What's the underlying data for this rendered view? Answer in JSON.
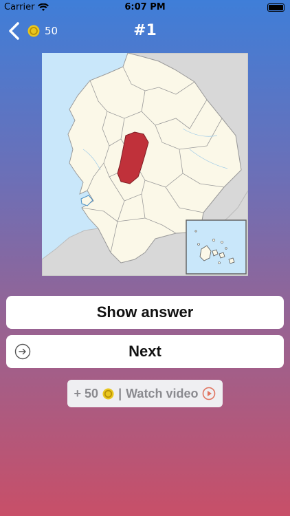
{
  "status_bar": {
    "carrier": "Carrier",
    "time": "6:07 PM"
  },
  "nav": {
    "coins": "50",
    "title": "#1"
  },
  "buttons": {
    "show_answer": "Show answer",
    "next": "Next"
  },
  "reward": {
    "amount": "+ 50",
    "separator": "|",
    "label": "Watch video"
  },
  "colors": {
    "highlight_region": "#c0313a",
    "land": "#fbf8e8",
    "sea": "#c9e7fa",
    "neighbor": "#d8d8d8"
  }
}
